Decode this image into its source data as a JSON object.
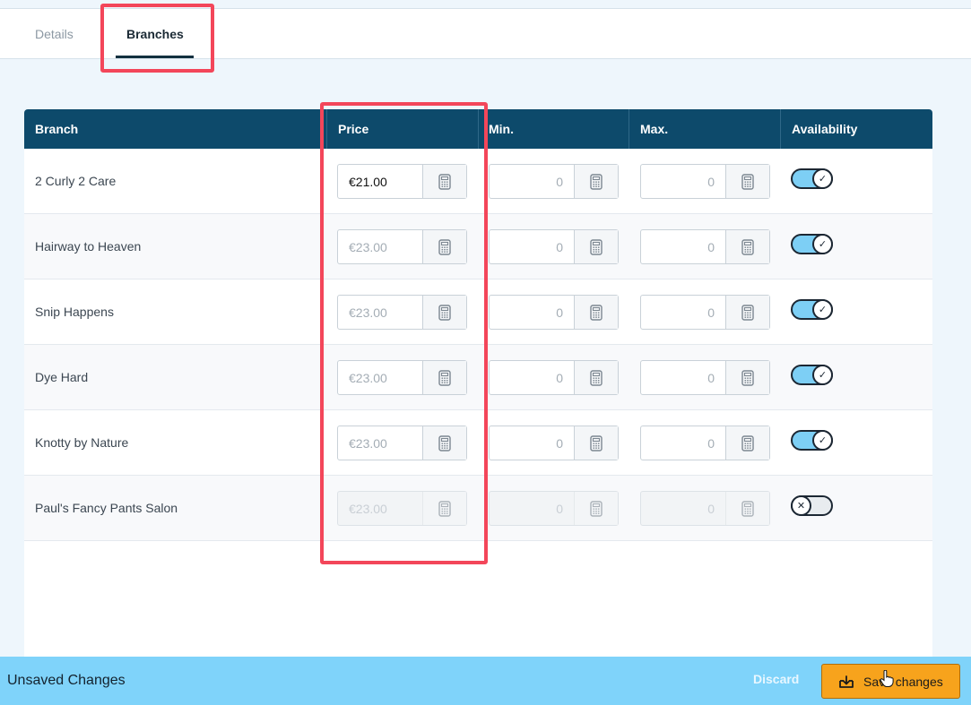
{
  "tabs": {
    "details_label": "Details",
    "branches_label": "Branches"
  },
  "table": {
    "headers": {
      "branch": "Branch",
      "price": "Price",
      "min": "Min.",
      "max": "Max.",
      "availability": "Availability"
    },
    "rows": [
      {
        "branch": "2 Curly 2 Care",
        "price": "€21.00",
        "price_state": "entered",
        "min": "0",
        "max": "0",
        "available": true
      },
      {
        "branch": "Hairway to Heaven",
        "price": "€23.00",
        "price_state": "placeholder",
        "min": "0",
        "max": "0",
        "available": true
      },
      {
        "branch": "Snip Happens",
        "price": "€23.00",
        "price_state": "placeholder",
        "min": "0",
        "max": "0",
        "available": true
      },
      {
        "branch": "Dye Hard",
        "price": "€23.00",
        "price_state": "placeholder",
        "min": "0",
        "max": "0",
        "available": true
      },
      {
        "branch": "Knotty by Nature",
        "price": "€23.00",
        "price_state": "placeholder",
        "min": "0",
        "max": "0",
        "available": true
      },
      {
        "branch": "Paul's Fancy Pants Salon",
        "price": "€23.00",
        "price_state": "disabled",
        "min": "0",
        "max": "0",
        "available": false
      }
    ]
  },
  "icons": {
    "calculator": "calculator-icon",
    "toggle_on": "check-icon",
    "toggle_off": "x-icon",
    "save": "download-tray-icon"
  },
  "footer": {
    "title": "Unsaved Changes",
    "discard_label": "Discard",
    "save_label": "Save changes"
  },
  "colors": {
    "header_bg": "#0d4a6b",
    "accent": "#7fd3fa",
    "save_button": "#f7a31c",
    "highlight": "#f3465a"
  }
}
